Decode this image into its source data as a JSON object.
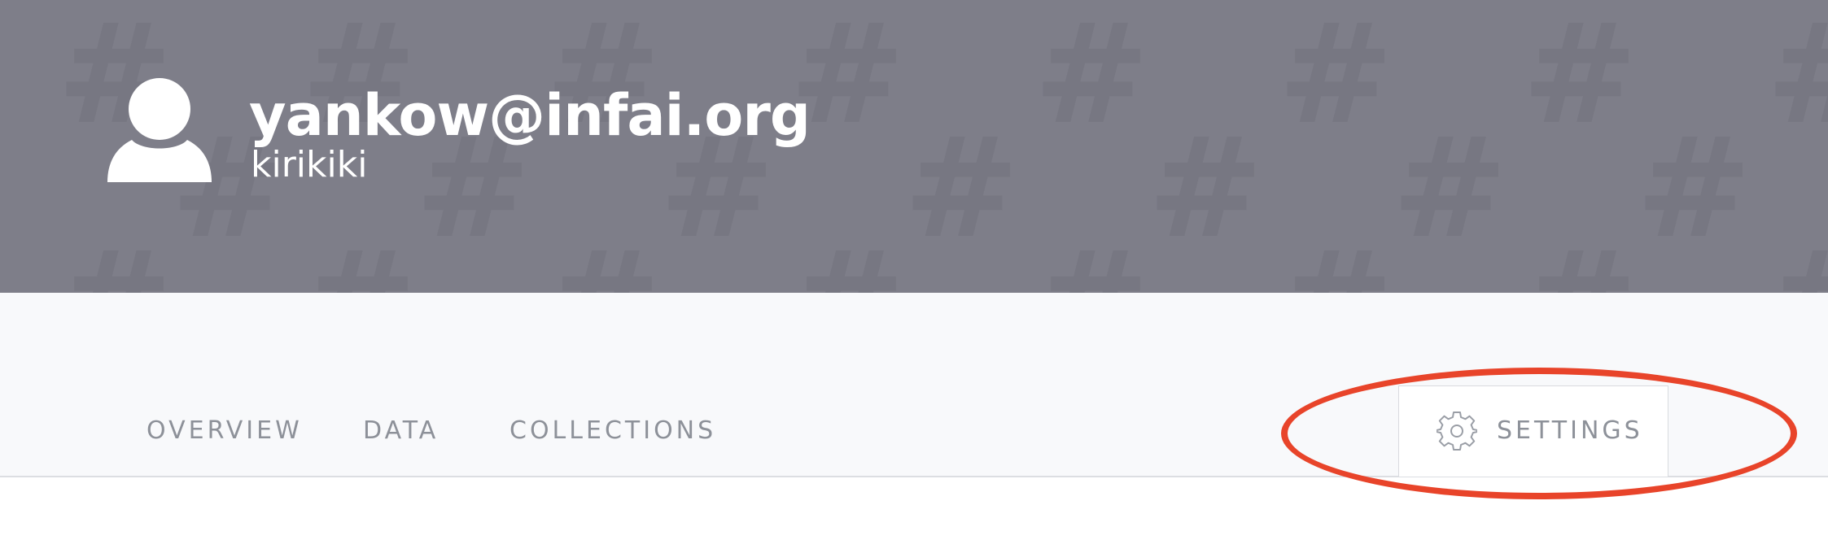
{
  "colors": {
    "banner_bg": "#7e7e89",
    "banner_pattern": "#777782",
    "nav_bg": "#f8f9fb",
    "tab_text": "#8d9199",
    "accent": "#e8442a"
  },
  "header": {
    "avatar_icon": "user-silhouette-icon",
    "email": "yankow@infai.org",
    "username": "kirikiki"
  },
  "tabs": [
    {
      "label": "OVERVIEW"
    },
    {
      "label": "DATA"
    },
    {
      "label": "COLLECTIONS"
    },
    {
      "label": "SETTINGS",
      "icon": "gear-icon",
      "active": true
    }
  ]
}
